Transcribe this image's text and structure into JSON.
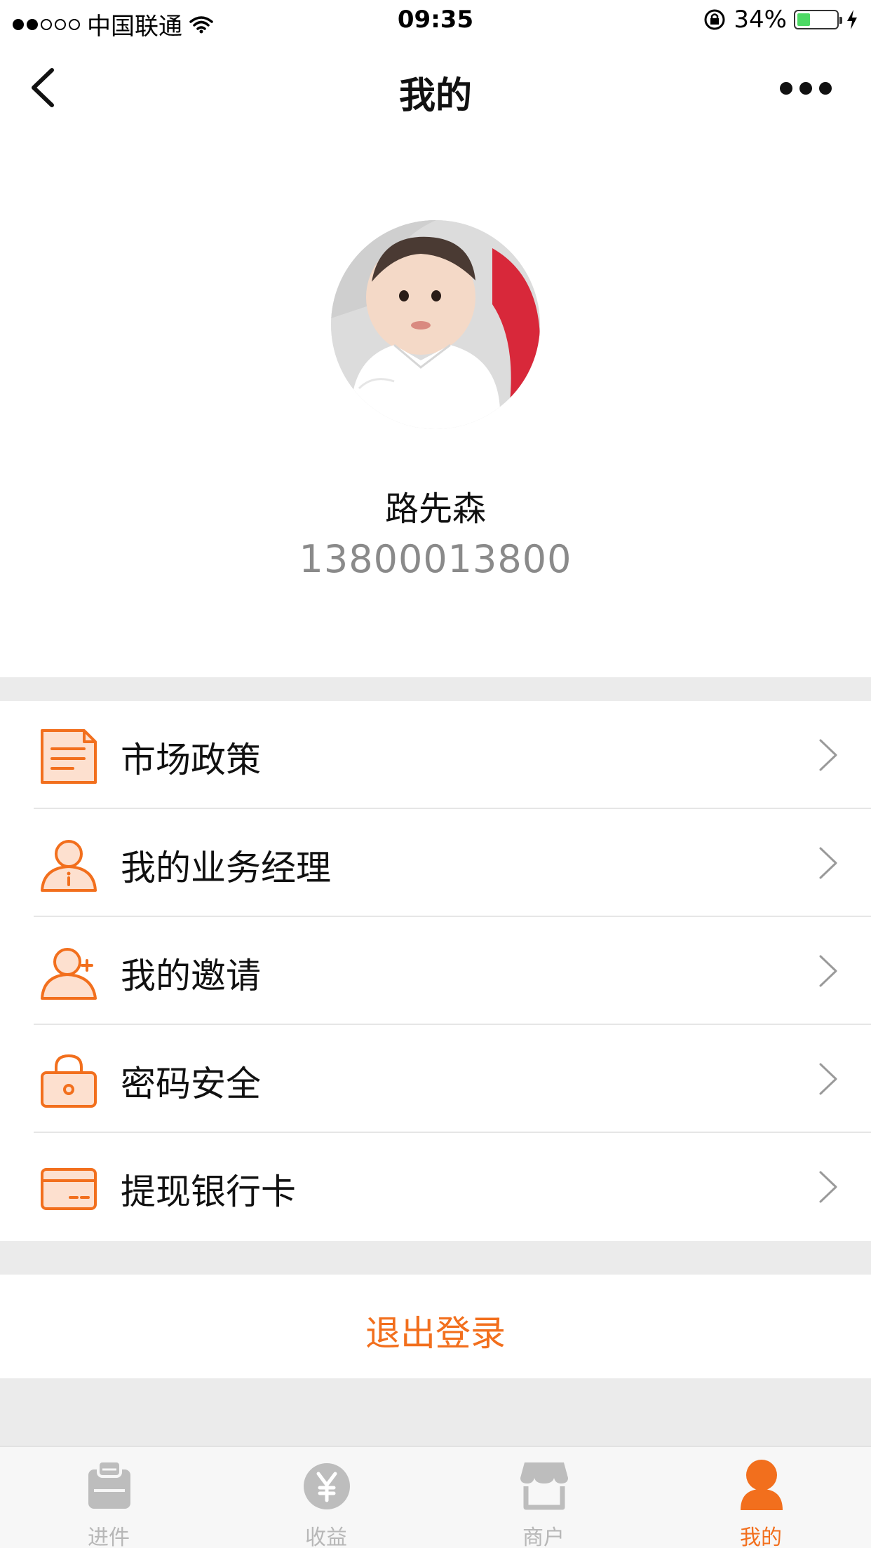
{
  "status_bar": {
    "carrier": "中国联通",
    "time": "09:35",
    "battery_percent": "34%",
    "battery_level": 0.34,
    "signal_strength_of_5": 2
  },
  "nav": {
    "title": "我的",
    "back_icon": "chevron-left-icon",
    "more_icon": "more-dots-icon"
  },
  "profile": {
    "name": "路先森",
    "phone": "13800013800"
  },
  "menu": {
    "items": [
      {
        "label": "市场政策",
        "icon": "document-icon"
      },
      {
        "label": "我的业务经理",
        "icon": "manager-icon"
      },
      {
        "label": "我的邀请",
        "icon": "invite-user-icon"
      },
      {
        "label": "密码安全",
        "icon": "lock-icon"
      },
      {
        "label": "提现银行卡",
        "icon": "bank-card-icon"
      }
    ]
  },
  "logout": {
    "label": "退出登录"
  },
  "tabs": [
    {
      "label": "进件",
      "icon": "clipboard-icon",
      "active": false
    },
    {
      "label": "收益",
      "icon": "yuan-icon",
      "active": false
    },
    {
      "label": "商户",
      "icon": "store-icon",
      "active": false
    },
    {
      "label": "我的",
      "icon": "person-icon",
      "active": true
    }
  ],
  "colors": {
    "accent": "#f26f1d",
    "icon_fill": "#fde0cf",
    "tab_inactive": "#b7b7b7",
    "background": "#ebebeb"
  }
}
